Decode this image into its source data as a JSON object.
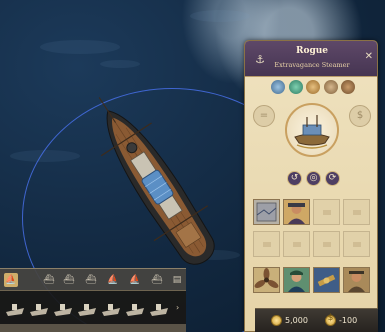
{
  "ship": {
    "name": "Rogue",
    "type": "Extravagance Steamer"
  },
  "icons": {
    "header": "anchor-icon",
    "close": "close-icon",
    "attributes": [
      "propeller-icon",
      "worker-icon",
      "cargo-icon",
      "compass-icon",
      "cog-icon"
    ],
    "left_button": "equals-icon",
    "right_button": "dollar-icon",
    "actions": [
      "return-icon",
      "target-icon",
      "repeat-icon"
    ],
    "items_top": [
      "map-item-icon",
      "captain-item-icon"
    ],
    "items_bottom": [
      "propeller-item-icon",
      "sailor-item-icon",
      "telescope-item-icon",
      "officer-item-icon"
    ],
    "coins": [
      "gold-coin-icon",
      "upkeep-coin-icon"
    ]
  },
  "economy": {
    "value": "5,000",
    "upkeep": "-100"
  },
  "colors": {
    "ocean": "#122840",
    "range_ring": "#4670e6",
    "panel_parchment": "#efe2bf",
    "panel_header": "#5e4868",
    "gold": "#c99a2e"
  },
  "fleet": {
    "ship_count": 7
  }
}
